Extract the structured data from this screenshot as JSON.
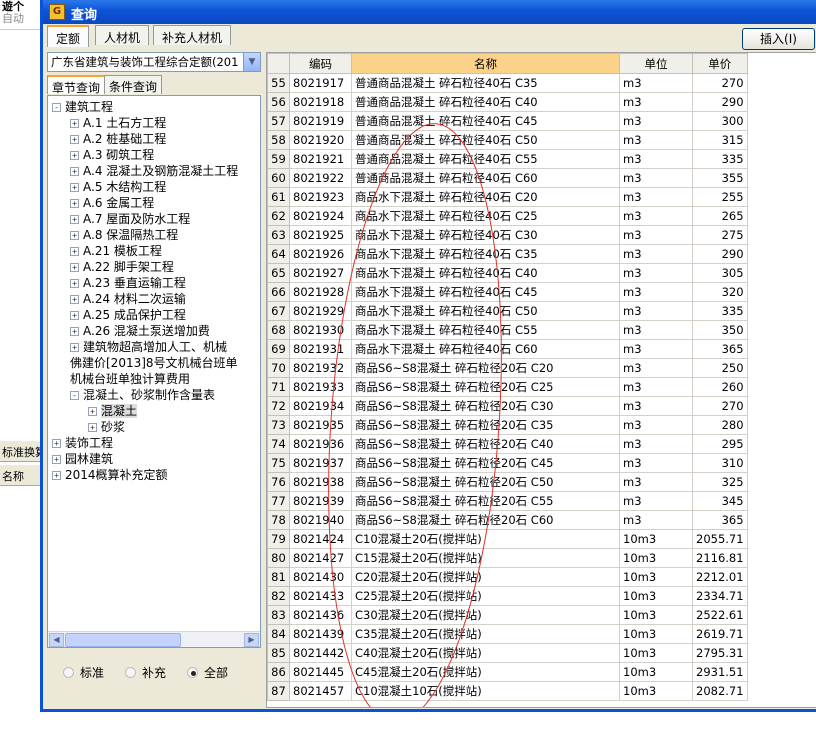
{
  "background": {
    "top_text": "遊个",
    "top_text2": "自动",
    "left_label1": "标准换算",
    "left_label2": "名称"
  },
  "dialog": {
    "title": "查询",
    "tabs": [
      "定额",
      "人材机",
      "补充人材机"
    ],
    "insert_button": "插入(I)",
    "library_select": "广东省建筑与装饰工程综合定额(201",
    "subtabs": [
      "章节查询",
      "条件查询"
    ]
  },
  "tree": [
    {
      "label": "建筑工程",
      "exp": "−",
      "level": 0
    },
    {
      "label": "A.1 土石方工程",
      "exp": "+",
      "level": 1
    },
    {
      "label": "A.2 桩基础工程",
      "exp": "+",
      "level": 1
    },
    {
      "label": "A.3 砌筑工程",
      "exp": "+",
      "level": 1
    },
    {
      "label": "A.4 混凝土及钢筋混凝土工程",
      "exp": "+",
      "level": 1
    },
    {
      "label": "A.5 木结构工程",
      "exp": "+",
      "level": 1
    },
    {
      "label": "A.6 金属工程",
      "exp": "+",
      "level": 1
    },
    {
      "label": "A.7 屋面及防水工程",
      "exp": "+",
      "level": 1
    },
    {
      "label": "A.8 保温隔热工程",
      "exp": "+",
      "level": 1
    },
    {
      "label": "A.21 模板工程",
      "exp": "+",
      "level": 1
    },
    {
      "label": "A.22 脚手架工程",
      "exp": "+",
      "level": 1
    },
    {
      "label": "A.23 垂直运输工程",
      "exp": "+",
      "level": 1
    },
    {
      "label": "A.24 材料二次运输",
      "exp": "+",
      "level": 1
    },
    {
      "label": "A.25 成品保护工程",
      "exp": "+",
      "level": 1
    },
    {
      "label": "A.26 混凝土泵送增加费",
      "exp": "+",
      "level": 1
    },
    {
      "label": "建筑物超高增加人工、机械",
      "exp": "+",
      "level": 1
    },
    {
      "label": "佛建价[2013]8号文机械台班单",
      "exp": "",
      "level": 1
    },
    {
      "label": "机械台班单独计算费用",
      "exp": "",
      "level": 1
    },
    {
      "label": "混凝土、砂浆制作含量表",
      "exp": "−",
      "level": 1
    },
    {
      "label": "混凝土",
      "exp": "+",
      "level": 2,
      "selected": true
    },
    {
      "label": "砂浆",
      "exp": "+",
      "level": 2
    },
    {
      "label": "装饰工程",
      "exp": "+",
      "level": 0
    },
    {
      "label": "园林建筑",
      "exp": "+",
      "level": 0
    },
    {
      "label": "2014概算补充定额",
      "exp": "+",
      "level": 0
    }
  ],
  "radios": [
    {
      "label": "标准",
      "checked": false
    },
    {
      "label": "补充",
      "checked": false
    },
    {
      "label": "全部",
      "checked": true
    }
  ],
  "grid": {
    "headers": [
      "编码",
      "名称",
      "单位",
      "单价"
    ],
    "rows": [
      [
        "55",
        "8021917",
        "普通商品混凝土 碎石粒径40石 C35",
        "m3",
        "270"
      ],
      [
        "56",
        "8021918",
        "普通商品混凝土 碎石粒径40石 C40",
        "m3",
        "290"
      ],
      [
        "57",
        "8021919",
        "普通商品混凝土 碎石粒径40石 C45",
        "m3",
        "300"
      ],
      [
        "58",
        "8021920",
        "普通商品混凝土 碎石粒径40石 C50",
        "m3",
        "315"
      ],
      [
        "59",
        "8021921",
        "普通商品混凝土 碎石粒径40石 C55",
        "m3",
        "335"
      ],
      [
        "60",
        "8021922",
        "普通商品混凝土 碎石粒径40石 C60",
        "m3",
        "355"
      ],
      [
        "61",
        "8021923",
        "商品水下混凝土 碎石粒径40石 C20",
        "m3",
        "255"
      ],
      [
        "62",
        "8021924",
        "商品水下混凝土 碎石粒径40石 C25",
        "m3",
        "265"
      ],
      [
        "63",
        "8021925",
        "商品水下混凝土 碎石粒径40石 C30",
        "m3",
        "275"
      ],
      [
        "64",
        "8021926",
        "商品水下混凝土 碎石粒径40石 C35",
        "m3",
        "290"
      ],
      [
        "65",
        "8021927",
        "商品水下混凝土 碎石粒径40石 C40",
        "m3",
        "305"
      ],
      [
        "66",
        "8021928",
        "商品水下混凝土 碎石粒径40石 C45",
        "m3",
        "320"
      ],
      [
        "67",
        "8021929",
        "商品水下混凝土 碎石粒径40石 C50",
        "m3",
        "335"
      ],
      [
        "68",
        "8021930",
        "商品水下混凝土 碎石粒径40石 C55",
        "m3",
        "350"
      ],
      [
        "69",
        "8021931",
        "商品水下混凝土 碎石粒径40石 C60",
        "m3",
        "365"
      ],
      [
        "70",
        "8021932",
        "商品S6~S8混凝土 碎石粒径20石 C20",
        "m3",
        "250"
      ],
      [
        "71",
        "8021933",
        "商品S6~S8混凝土 碎石粒径20石 C25",
        "m3",
        "260"
      ],
      [
        "72",
        "8021934",
        "商品S6~S8混凝土 碎石粒径20石 C30",
        "m3",
        "270"
      ],
      [
        "73",
        "8021935",
        "商品S6~S8混凝土 碎石粒径20石 C35",
        "m3",
        "280"
      ],
      [
        "74",
        "8021936",
        "商品S6~S8混凝土 碎石粒径20石 C40",
        "m3",
        "295"
      ],
      [
        "75",
        "8021937",
        "商品S6~S8混凝土 碎石粒径20石 C45",
        "m3",
        "310"
      ],
      [
        "76",
        "8021938",
        "商品S6~S8混凝土 碎石粒径20石 C50",
        "m3",
        "325"
      ],
      [
        "77",
        "8021939",
        "商品S6~S8混凝土 碎石粒径20石 C55",
        "m3",
        "345"
      ],
      [
        "78",
        "8021940",
        "商品S6~S8混凝土 碎石粒径20石 C60",
        "m3",
        "365"
      ],
      [
        "79",
        "8021424",
        "C10混凝土20石(搅拌站)",
        "10m3",
        "2055.71"
      ],
      [
        "80",
        "8021427",
        "C15混凝土20石(搅拌站)",
        "10m3",
        "2116.81"
      ],
      [
        "81",
        "8021430",
        "C20混凝土20石(搅拌站)",
        "10m3",
        "2212.01"
      ],
      [
        "82",
        "8021433",
        "C25混凝土20石(搅拌站)",
        "10m3",
        "2334.71"
      ],
      [
        "83",
        "8021436",
        "C30混凝土20石(搅拌站)",
        "10m3",
        "2522.61"
      ],
      [
        "84",
        "8021439",
        "C35混凝土20石(搅拌站)",
        "10m3",
        "2619.71"
      ],
      [
        "85",
        "8021442",
        "C40混凝土20石(搅拌站)",
        "10m3",
        "2795.31"
      ],
      [
        "86",
        "8021445",
        "C45混凝土20石(搅拌站)",
        "10m3",
        "2931.51"
      ],
      [
        "87",
        "8021457",
        "C10混凝土10石(搅拌站)",
        "10m3",
        "2082.71"
      ]
    ]
  },
  "colors": {
    "title_bar": "#0d52d6",
    "header_highlight": "#fbd28a",
    "annotation": "#e0312a"
  }
}
